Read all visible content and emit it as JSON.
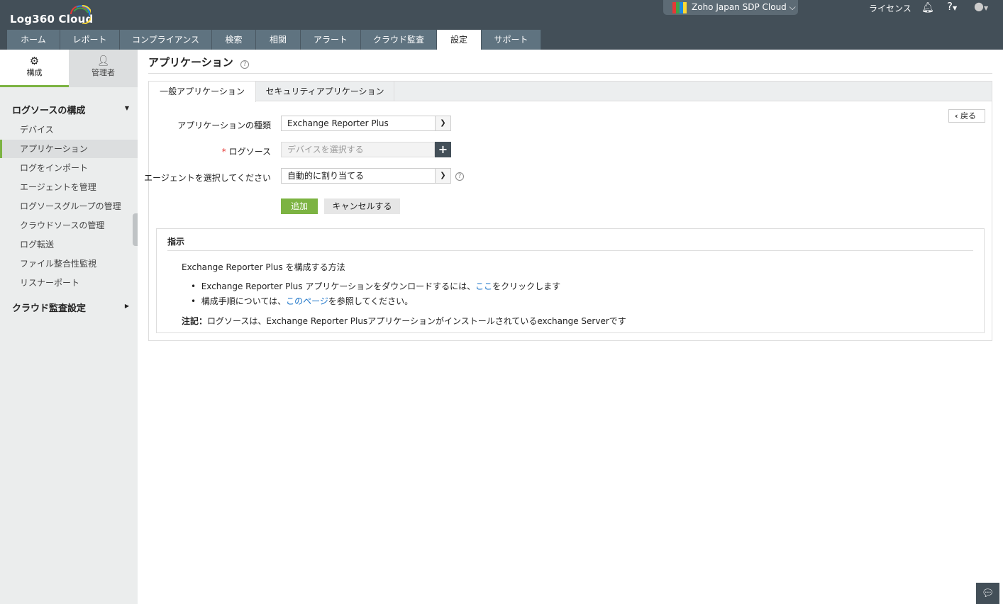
{
  "header": {
    "logo": "Log360 Cloud",
    "org": "Zoho Japan SDP Cloud",
    "license": "ライセンス",
    "help": "?"
  },
  "nav": [
    "ホーム",
    "レポート",
    "コンプライアンス",
    "検索",
    "相関",
    "アラート",
    "クラウド監査",
    "設定",
    "サポート"
  ],
  "sidebar": {
    "tabs": [
      "構成",
      "管理者"
    ],
    "section1": "ログソースの構成",
    "items": [
      "デバイス",
      "アプリケーション",
      "ログをインポート",
      "エージェントを管理",
      "ログソースグループの管理",
      "クラウドソースの管理",
      "ログ転送",
      "ファイル整合性監視",
      "リスナーポート"
    ],
    "section2": "クラウド監査設定"
  },
  "page": {
    "title": "アプリケーション",
    "tabs": [
      "一般アプリケーション",
      "セキュリティアプリケーション"
    ],
    "back": "戻る",
    "form": {
      "type_label": "アプリケーションの種類",
      "type_value": "Exchange Reporter Plus",
      "source_label": "ログソース",
      "source_placeholder": "デバイスを選択する",
      "agent_label": "エージェントを選択してください",
      "agent_value": "自動的に割り当てる",
      "add": "追加",
      "cancel": "キャンセルする"
    },
    "instructions": {
      "title": "指示",
      "heading": "Exchange Reporter Plus を構成する方法",
      "b1_pre": "Exchange Reporter Plus アプリケーションをダウンロードするには、",
      "b1_link": "ここ",
      "b1_post": "をクリックします",
      "b2_pre": "構成手順については、",
      "b2_link": "このページ",
      "b2_post": "を参照してください。",
      "note_label": "注記：",
      "note": "ログソースは、Exchange Reporter Plusアプリケーションがインストールされているexchange Serverです"
    }
  }
}
